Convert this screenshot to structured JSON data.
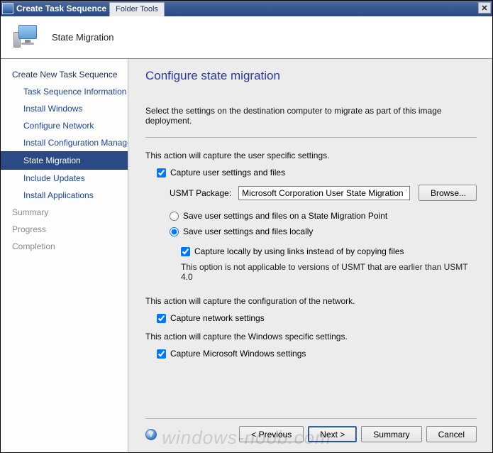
{
  "titlebar": {
    "title": "Create Task Sequence",
    "tool_tab": "Folder Tools",
    "close_symbol": "✕"
  },
  "banner": {
    "title": "State Migration"
  },
  "sidebar": {
    "items": [
      {
        "label": "Create New Task Sequence",
        "level": "top"
      },
      {
        "label": "Task Sequence Information",
        "level": "sub"
      },
      {
        "label": "Install Windows",
        "level": "sub"
      },
      {
        "label": "Configure Network",
        "level": "sub"
      },
      {
        "label": "Install Configuration Manager",
        "level": "sub"
      },
      {
        "label": "State Migration",
        "level": "sub",
        "selected": true
      },
      {
        "label": "Include Updates",
        "level": "sub"
      },
      {
        "label": "Install Applications",
        "level": "sub"
      },
      {
        "label": "Summary",
        "level": "top",
        "dim": true
      },
      {
        "label": "Progress",
        "level": "top",
        "dim": true
      },
      {
        "label": "Completion",
        "level": "top",
        "dim": true
      }
    ]
  },
  "main": {
    "heading": "Configure state migration",
    "intro": "Select the settings on the destination computer to migrate as part of this image deployment.",
    "user_section_text": "This action will capture the user specific settings.",
    "capture_user_label": "Capture user settings and files",
    "usmt_label": "USMT Package:",
    "usmt_value": "Microsoft Corporation User State Migration Tool",
    "browse_label": "Browse...",
    "radio_smp": "Save user settings and files on a State Migration Point",
    "radio_local": "Save user settings and files locally",
    "capture_links": "Capture locally by using links instead of by copying files",
    "note": "This option is not applicable to versions of USMT that are earlier than USMT 4.0",
    "network_section_text": "This action will capture the configuration of the network.",
    "capture_network": "Capture network settings",
    "windows_section_text": "This action will capture the Windows specific settings.",
    "capture_windows": "Capture Microsoft Windows settings"
  },
  "footer": {
    "help_symbol": "?",
    "previous": "< Previous",
    "next": "Next >",
    "summary": "Summary",
    "cancel": "Cancel"
  },
  "watermark": "windows-noob.com"
}
